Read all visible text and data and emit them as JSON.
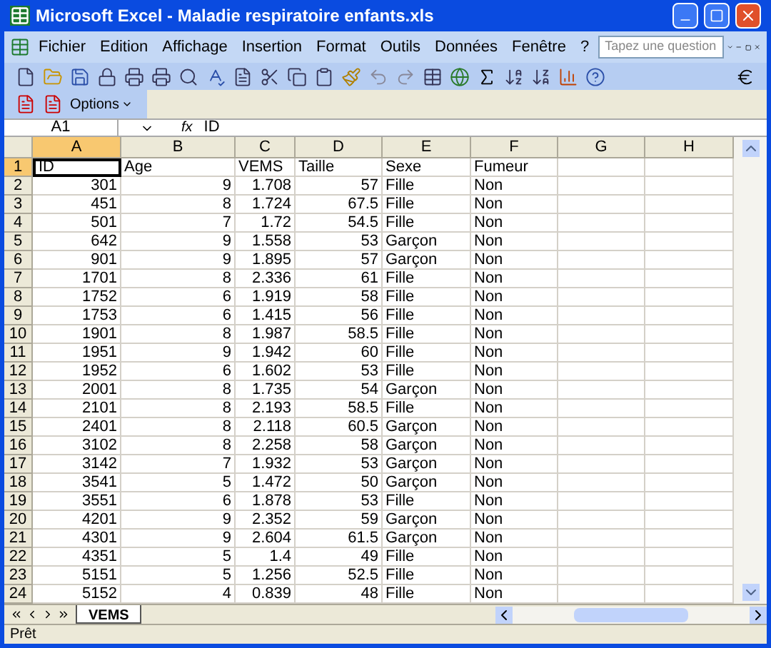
{
  "window": {
    "title": "Microsoft Excel - Maladie respiratoire enfants.xls"
  },
  "menu": [
    "Fichier",
    "Edition",
    "Affichage",
    "Insertion",
    "Format",
    "Outils",
    "Données",
    "Fenêtre",
    "?"
  ],
  "help_box": {
    "placeholder": "Tapez une question"
  },
  "options_button": "Options",
  "formula_bar": {
    "name_box": "A1",
    "fx": "fx",
    "value": "ID"
  },
  "columns": [
    {
      "label": "A",
      "kind": "numeric",
      "selected": true
    },
    {
      "label": "B",
      "kind": "numeric",
      "selected": false
    },
    {
      "label": "C",
      "kind": "numeric",
      "selected": false
    },
    {
      "label": "D",
      "kind": "numeric",
      "selected": false
    },
    {
      "label": "E",
      "kind": "text",
      "selected": false
    },
    {
      "label": "F",
      "kind": "text",
      "selected": false
    },
    {
      "label": "G",
      "kind": "text",
      "selected": false
    },
    {
      "label": "H",
      "kind": "text",
      "selected": false
    }
  ],
  "rows": [
    {
      "number": "1",
      "kind": "heading",
      "selected": true,
      "cells": [
        "ID",
        "Age",
        "VEMS",
        "Taille",
        "Sexe",
        "Fumeur"
      ]
    },
    {
      "number": "2",
      "kind": "data",
      "selected": false,
      "cells": [
        "301",
        "9",
        "1.708",
        "57",
        "Fille",
        "Non"
      ]
    },
    {
      "number": "3",
      "kind": "data",
      "selected": false,
      "cells": [
        "451",
        "8",
        "1.724",
        "67.5",
        "Fille",
        "Non"
      ]
    },
    {
      "number": "4",
      "kind": "data",
      "selected": false,
      "cells": [
        "501",
        "7",
        "1.72",
        "54.5",
        "Fille",
        "Non"
      ]
    },
    {
      "number": "5",
      "kind": "data",
      "selected": false,
      "cells": [
        "642",
        "9",
        "1.558",
        "53",
        "Garçon",
        "Non"
      ]
    },
    {
      "number": "6",
      "kind": "data",
      "selected": false,
      "cells": [
        "901",
        "9",
        "1.895",
        "57",
        "Garçon",
        "Non"
      ]
    },
    {
      "number": "7",
      "kind": "data",
      "selected": false,
      "cells": [
        "1701",
        "8",
        "2.336",
        "61",
        "Fille",
        "Non"
      ]
    },
    {
      "number": "8",
      "kind": "data",
      "selected": false,
      "cells": [
        "1752",
        "6",
        "1.919",
        "58",
        "Fille",
        "Non"
      ]
    },
    {
      "number": "9",
      "kind": "data",
      "selected": false,
      "cells": [
        "1753",
        "6",
        "1.415",
        "56",
        "Fille",
        "Non"
      ]
    },
    {
      "number": "10",
      "kind": "data",
      "selected": false,
      "cells": [
        "1901",
        "8",
        "1.987",
        "58.5",
        "Fille",
        "Non"
      ]
    },
    {
      "number": "11",
      "kind": "data",
      "selected": false,
      "cells": [
        "1951",
        "9",
        "1.942",
        "60",
        "Fille",
        "Non"
      ]
    },
    {
      "number": "12",
      "kind": "data",
      "selected": false,
      "cells": [
        "1952",
        "6",
        "1.602",
        "53",
        "Fille",
        "Non"
      ]
    },
    {
      "number": "13",
      "kind": "data",
      "selected": false,
      "cells": [
        "2001",
        "8",
        "1.735",
        "54",
        "Garçon",
        "Non"
      ]
    },
    {
      "number": "14",
      "kind": "data",
      "selected": false,
      "cells": [
        "2101",
        "8",
        "2.193",
        "58.5",
        "Fille",
        "Non"
      ]
    },
    {
      "number": "15",
      "kind": "data",
      "selected": false,
      "cells": [
        "2401",
        "8",
        "2.118",
        "60.5",
        "Garçon",
        "Non"
      ]
    },
    {
      "number": "16",
      "kind": "data",
      "selected": false,
      "cells": [
        "3102",
        "8",
        "2.258",
        "58",
        "Garçon",
        "Non"
      ]
    },
    {
      "number": "17",
      "kind": "data",
      "selected": false,
      "cells": [
        "3142",
        "7",
        "1.932",
        "53",
        "Garçon",
        "Non"
      ]
    },
    {
      "number": "18",
      "kind": "data",
      "selected": false,
      "cells": [
        "3541",
        "5",
        "1.472",
        "50",
        "Garçon",
        "Non"
      ]
    },
    {
      "number": "19",
      "kind": "data",
      "selected": false,
      "cells": [
        "3551",
        "6",
        "1.878",
        "53",
        "Fille",
        "Non"
      ]
    },
    {
      "number": "20",
      "kind": "data",
      "selected": false,
      "cells": [
        "4201",
        "9",
        "2.352",
        "59",
        "Garçon",
        "Non"
      ]
    },
    {
      "number": "21",
      "kind": "data",
      "selected": false,
      "cells": [
        "4301",
        "9",
        "2.604",
        "61.5",
        "Garçon",
        "Non"
      ]
    },
    {
      "number": "22",
      "kind": "data",
      "selected": false,
      "cells": [
        "4351",
        "5",
        "1.4",
        "49",
        "Fille",
        "Non"
      ]
    },
    {
      "number": "23",
      "kind": "data",
      "selected": false,
      "cells": [
        "5151",
        "5",
        "1.256",
        "52.5",
        "Fille",
        "Non"
      ]
    },
    {
      "number": "24",
      "kind": "data",
      "selected": false,
      "cells": [
        "5152",
        "4",
        "0.839",
        "48",
        "Fille",
        "Non"
      ]
    }
  ],
  "sheet_tabs": [
    {
      "label": "VEMS",
      "selected": true
    }
  ],
  "status_bar": "Prêt"
}
